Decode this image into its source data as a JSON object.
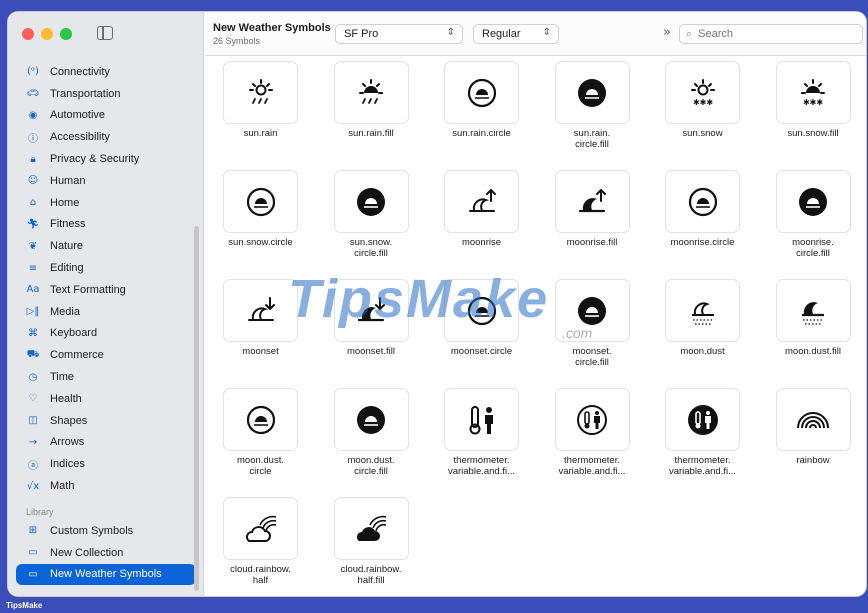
{
  "sidebar": {
    "items": [
      {
        "label": "Connectivity",
        "icon": "(ᵒ)"
      },
      {
        "label": "Transportation",
        "icon": "🚗︎"
      },
      {
        "label": "Automotive",
        "icon": "◉"
      },
      {
        "label": "Accessibility",
        "icon": "ⓘ"
      },
      {
        "label": "Privacy & Security",
        "icon": "🔒︎"
      },
      {
        "label": "Human",
        "icon": "☺"
      },
      {
        "label": "Home",
        "icon": "⌂"
      },
      {
        "label": "Fitness",
        "icon": "🏃︎"
      },
      {
        "label": "Nature",
        "icon": "❦"
      },
      {
        "label": "Editing",
        "icon": "≡"
      },
      {
        "label": "Text Formatting",
        "icon": "Aa"
      },
      {
        "label": "Media",
        "icon": "▷‖"
      },
      {
        "label": "Keyboard",
        "icon": "⌘"
      },
      {
        "label": "Commerce",
        "icon": "⛟"
      },
      {
        "label": "Time",
        "icon": "◷"
      },
      {
        "label": "Health",
        "icon": "♡"
      },
      {
        "label": "Shapes",
        "icon": "◫"
      },
      {
        "label": "Arrows",
        "icon": "→"
      },
      {
        "label": "Indices",
        "icon": "ⓐ"
      },
      {
        "label": "Math",
        "icon": "√x"
      }
    ],
    "library_heading": "Library",
    "library_items": [
      {
        "label": "Custom Symbols",
        "icon": "⊞"
      },
      {
        "label": "New Collection",
        "icon": "▭"
      },
      {
        "label": "New Weather Symbols",
        "icon": "▭",
        "active": true
      }
    ]
  },
  "toolbar": {
    "title": "New Weather Symbols",
    "subtitle": "26 Symbols",
    "font_select": "SF Pro",
    "weight_select": "Regular",
    "search_placeholder": "Search"
  },
  "symbols": [
    {
      "label": "sun.rain",
      "glyph": "sunrain"
    },
    {
      "label": "sun.rain.fill",
      "glyph": "sunrainfill"
    },
    {
      "label": "sun.rain.circle",
      "glyph": "circ"
    },
    {
      "label": "sun.rain.\ncircle.fill",
      "glyph": "circfill"
    },
    {
      "label": "sun.snow",
      "glyph": "sunsnow"
    },
    {
      "label": "sun.snow.fill",
      "glyph": "sunsnowfill"
    },
    {
      "label": "sun.snow.circle",
      "glyph": "circ"
    },
    {
      "label": "sun.snow.\ncircle.fill",
      "glyph": "circfill"
    },
    {
      "label": "moonrise",
      "glyph": "moonrise"
    },
    {
      "label": "moonrise.fill",
      "glyph": "moonrisefill"
    },
    {
      "label": "moonrise.circle",
      "glyph": "circ"
    },
    {
      "label": "moonrise.\ncircle.fill",
      "glyph": "circfill"
    },
    {
      "label": "moonset",
      "glyph": "moonset"
    },
    {
      "label": "moonset.fill",
      "glyph": "moonsetfill"
    },
    {
      "label": "moonset.circle",
      "glyph": "circ"
    },
    {
      "label": "moonset.\ncircle.fill",
      "glyph": "circfill"
    },
    {
      "label": "moon.dust",
      "glyph": "moondust"
    },
    {
      "label": "moon.dust.fill",
      "glyph": "moondustfill"
    },
    {
      "label": "moon.dust.\ncircle",
      "glyph": "circ"
    },
    {
      "label": "moon.dust.\ncircle.fill",
      "glyph": "circfill"
    },
    {
      "label": "thermometer.\nvariable.and.fi...",
      "glyph": "thermo"
    },
    {
      "label": "thermometer.\nvariable.and.fi...",
      "glyph": "thermocirc"
    },
    {
      "label": "thermometer.\nvariable.and.fi...",
      "glyph": "thermocircfill"
    },
    {
      "label": "rainbow",
      "glyph": "rainbow"
    },
    {
      "label": "cloud.rainbow.\nhalf",
      "glyph": "cloudrainbow"
    },
    {
      "label": "cloud.rainbow.\nhalf.fill",
      "glyph": "cloudrainbowfill"
    }
  ],
  "watermark": {
    "text": "TipsMake",
    "sub": ".com"
  },
  "footer": {
    "brand": "TipsMake"
  }
}
